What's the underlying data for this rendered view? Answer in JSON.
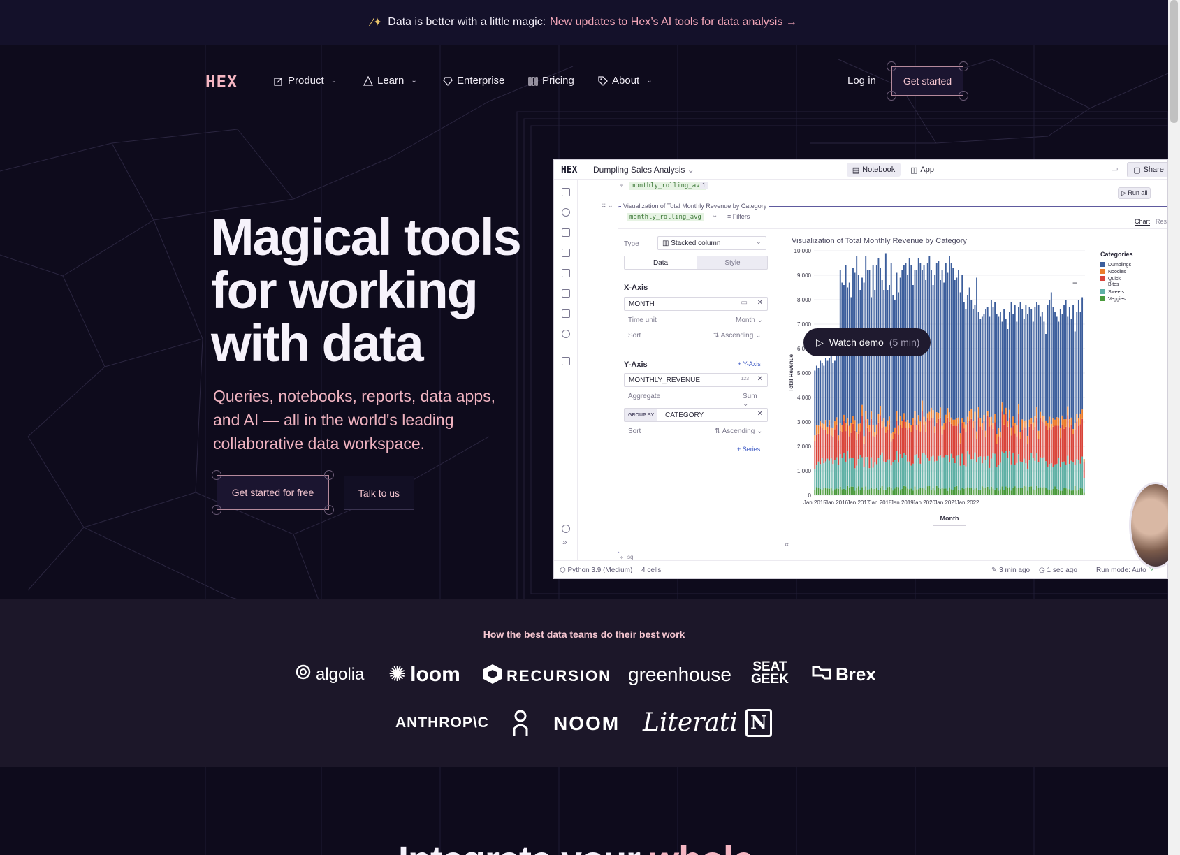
{
  "announcement": {
    "prefix": "Data is better with a little magic:",
    "link": "New updates to Hex’s AI tools for data analysis →"
  },
  "nav": {
    "logo": "HEX",
    "items": [
      {
        "label": "Product",
        "icon": "pencil-square-icon",
        "has_menu": true
      },
      {
        "label": "Learn",
        "icon": "triangle-icon",
        "has_menu": true
      },
      {
        "label": "Enterprise",
        "icon": "diamond-icon",
        "has_menu": false
      },
      {
        "label": "Pricing",
        "icon": "bars-icon",
        "has_menu": false
      },
      {
        "label": "About",
        "icon": "tag-icon",
        "has_menu": true
      }
    ],
    "login": "Log in",
    "get_started": "Get started"
  },
  "hero": {
    "title": "Magical tools for working with data",
    "subtitle": "Queries, notebooks, reports, data apps, and AI — all in the world's leading collaborative data workspace.",
    "cta_primary": "Get started for free",
    "cta_secondary": "Talk to us"
  },
  "app": {
    "logo": "HEX",
    "project_title": "Dumpling Sales Analysis",
    "tab_notebook": "Notebook",
    "tab_app": "App",
    "share": "Share",
    "run_all": "Run all",
    "upstream_cell": "monthly_rolling_avg",
    "upstream_count": "1",
    "cell_title": "Visualization of Total Monthly Revenue by Category",
    "dataframe": "monthly_rolling_avg",
    "filters": "Filters",
    "view_tabs": [
      "Chart",
      "Res"
    ],
    "config": {
      "type_label": "Type",
      "type_value": "Stacked column",
      "tab_data": "Data",
      "tab_style": "Style",
      "xaxis_heading": "X-Axis",
      "xaxis_field": "MONTH",
      "time_unit_label": "Time unit",
      "time_unit_value": "Month",
      "x_sort_label": "Sort",
      "x_sort_value": "Ascending",
      "yaxis_heading": "Y-Axis",
      "add_yaxis": "+ Y-Axis",
      "yaxis_field": "MONTHLY_REVENUE",
      "yaxis_type": "123",
      "aggregate_label": "Aggregate",
      "aggregate_value": "Sum",
      "group_by_label": "GROUP BY",
      "group_by_value": "CATEGORY",
      "g_sort_label": "Sort",
      "g_sort_value": "Ascending",
      "add_series": "+ Series"
    },
    "footer": {
      "runtime": "Python 3.9 (Medium)",
      "cells": "4 cells",
      "edited": "3 min ago",
      "ran": "1 sec ago",
      "run_mode": "Run mode: Auto"
    },
    "sql_label": "sql"
  },
  "watch_demo": {
    "label": "Watch demo",
    "duration": "(5 min)"
  },
  "chart_data": {
    "type": "bar",
    "title": "Visualization of Total Monthly Revenue by Category",
    "xlabel": "Month",
    "ylabel": "Total Revenue",
    "ylim": [
      0,
      10000
    ],
    "yticks": [
      "0",
      "1,000",
      "2,000",
      "3,000",
      "4,000",
      "5,000",
      "6,000",
      "7,000",
      "8,000",
      "9,000",
      "10,000"
    ],
    "xticks": [
      "Jan 2015",
      "Jan 2016",
      "Jan 2017",
      "Jan 2018",
      "Jan 2019",
      "Jan 2020",
      "Jan 2021",
      "Jan 2022"
    ],
    "legend_title": "Categories",
    "legend_position": "right",
    "stacked": true,
    "series": [
      {
        "name": "Veggies",
        "color": "#4a9a3c"
      },
      {
        "name": "Sweets",
        "color": "#5fb0a5"
      },
      {
        "name": "Quick Bites",
        "color": "#d9443a"
      },
      {
        "name": "Noodles",
        "color": "#ec7d2c"
      },
      {
        "name": "Dumplings",
        "color": "#3c5e9c"
      }
    ],
    "totals": [
      5100,
      5300,
      5200,
      5500,
      5400,
      5300,
      5600,
      5500,
      5600,
      5700,
      5400,
      5500,
      5800,
      5700,
      9200,
      8700,
      8600,
      9400,
      8500,
      8700,
      8100,
      9300,
      9100,
      9800,
      9000,
      8400,
      8900,
      8700,
      9800,
      9200,
      9200,
      8100,
      9400,
      8400,
      9400,
      9700,
      9300,
      8800,
      8400,
      9900,
      8400,
      8600,
      9500,
      8200,
      8000,
      9100,
      8300,
      8900,
      9200,
      9400,
      9500,
      9000,
      9700,
      9400,
      8600,
      9200,
      9200,
      9700,
      9500,
      9200,
      9400,
      8800,
      9500,
      9800,
      9200,
      8600,
      9000,
      9500,
      9600,
      8800,
      9200,
      8700,
      9500,
      9100,
      9800,
      9500,
      9300,
      8800,
      8900,
      9200,
      8300,
      9000,
      7900,
      7600,
      8200,
      8500,
      8000,
      7600,
      7800,
      8900,
      7500,
      7200,
      7300,
      7400,
      7600,
      7700,
      7300,
      8000,
      7700,
      7900,
      7400,
      7300,
      7500,
      7100,
      7600,
      7200,
      6800,
      7500,
      7900,
      7400,
      7800,
      7100,
      7700,
      7900,
      7600,
      7200,
      7800,
      7400,
      7700,
      7600,
      7100,
      7700,
      7900,
      7800,
      7300,
      7500,
      7100,
      6600,
      7800,
      8000,
      8300,
      7700,
      7500,
      7300,
      7100,
      7600,
      7400,
      7800,
      8000,
      7300,
      7700,
      7200,
      7800,
      6700,
      7500,
      8000,
      7500,
      8100,
      1300
    ]
  },
  "social_proof": {
    "heading": "How the best data teams do their best work",
    "row1": [
      "algolia",
      "loom",
      "RECURSION",
      "greenhouse",
      "SEAT GEEK",
      "Brex"
    ],
    "row2": [
      "ANTHROP\\C",
      "",
      "NOOM",
      "Literati",
      "N"
    ]
  },
  "next_section": {
    "title_start": "Integrate your ",
    "title_highlight": "whole"
  }
}
